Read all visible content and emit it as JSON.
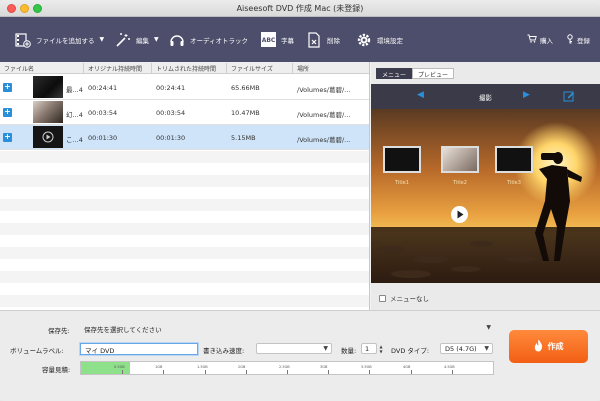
{
  "window": {
    "title": "Aiseesoft DVD 作成 Mac (未登録)"
  },
  "toolbar": {
    "add_file": "ファイルを追加する",
    "edit": "編集",
    "audio_track": "オーディオトラック",
    "subtitle": "字幕",
    "delete": "削除",
    "settings": "環境設定",
    "purchase": "購入",
    "register": "登録"
  },
  "table": {
    "headers": [
      "ファイル名",
      "オリジナル持続時間",
      "トリムされた持続時間",
      "ファイルサイズ",
      "場所"
    ],
    "rows": [
      {
        "name": "最...4",
        "original": "00:24:41",
        "trimmed": "00:24:41",
        "size": "65.66MB",
        "location": "/Volumes/葛碧/...",
        "selected": false
      },
      {
        "name": "幻...4",
        "original": "00:03:54",
        "trimmed": "00:03:54",
        "size": "10.47MB",
        "location": "/Volumes/葛碧/...",
        "selected": false
      },
      {
        "name": "こ...4",
        "original": "00:01:30",
        "trimmed": "00:01:30",
        "size": "5.15MB",
        "location": "/Volumes/葛碧/...",
        "selected": true
      }
    ]
  },
  "preview": {
    "tabs": [
      "メニュー",
      "プレビュー"
    ],
    "active_tab": "メニュー",
    "nav_label": "撮影",
    "titles": [
      "Title1",
      "Title2",
      "Title3"
    ],
    "no_menu_label": "メニューなし",
    "no_menu_checked": false
  },
  "bottom": {
    "save_to_label": "保存先:",
    "save_to_value": "保存先を選択してください",
    "volume_label": "ボリュームラベル:",
    "volume_value": "マイ DVD",
    "write_speed_label": "書き込み速度:",
    "write_speed_value": "",
    "copies_label": "数量:",
    "copies_value": "1",
    "dvd_type_label": "DVD タイプ:",
    "dvd_type_value": "D5 (4.7G)",
    "capacity_label": "容量見積:",
    "capacity_ticks": [
      "0.5GB",
      "1GB",
      "1.5GB",
      "2GB",
      "2.5GB",
      "3GB",
      "3.5GB",
      "4GB",
      "4.5GB"
    ],
    "capacity_used_gb": 0.6,
    "create_label": "作成"
  },
  "colors": {
    "toolbar_bg": "#4d4e6b",
    "accent_blue": "#2a8fd8",
    "selected_row": "#cfe4f8",
    "create_button": "#f26d1f",
    "capacity_fill": "#8ee08a"
  }
}
